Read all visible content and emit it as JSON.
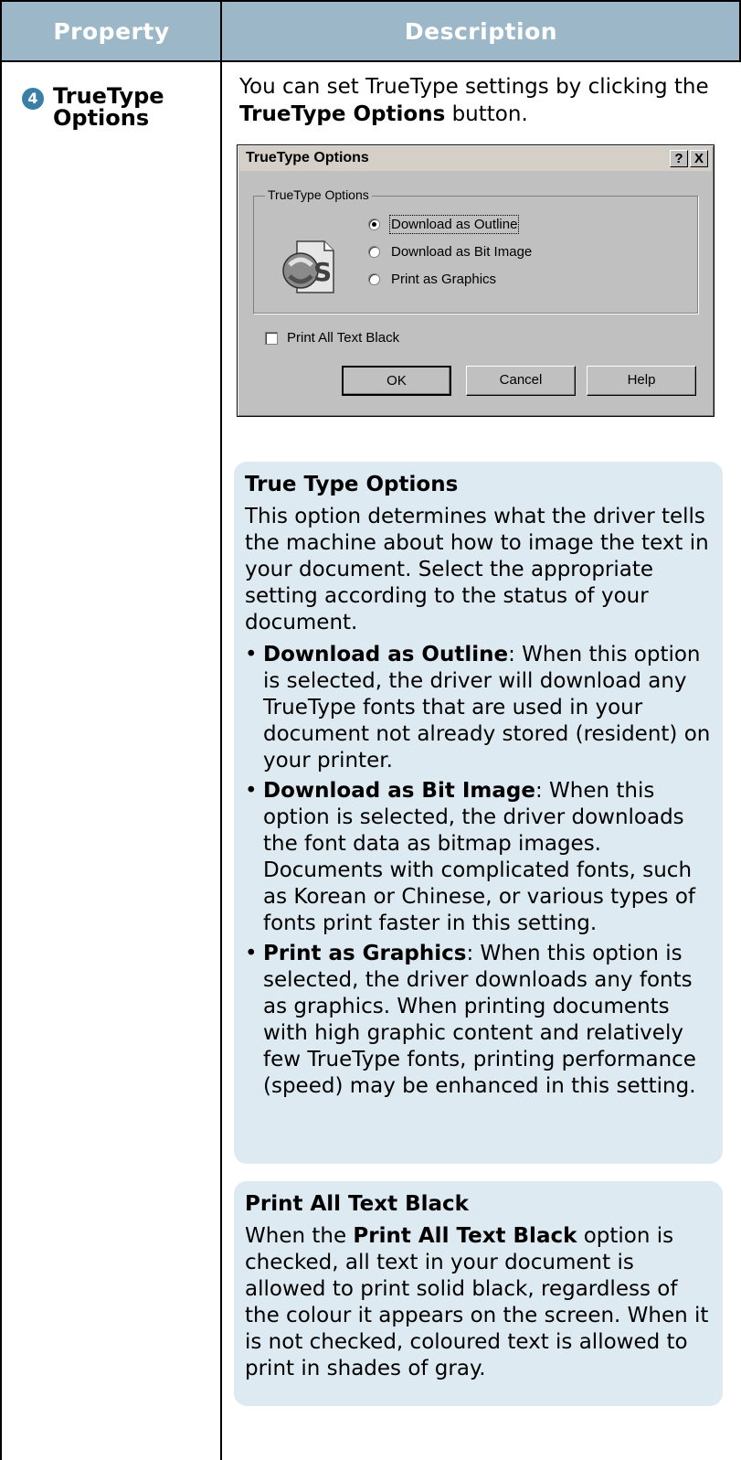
{
  "table": {
    "header": {
      "property": "Property",
      "description": "Description"
    },
    "row": {
      "number": "4",
      "property": "TrueType Options",
      "intro_text_1": "You can set TrueType settings by clicking the ",
      "intro_bold": "TrueType Options",
      "intro_text_2": " button."
    }
  },
  "dialog": {
    "title": "TrueType Options",
    "help_button": "?",
    "close_button": "X",
    "group_label": "TrueType Options",
    "radios": [
      {
        "label": "Download as Outline",
        "checked": true
      },
      {
        "label": "Download as Bit Image",
        "checked": false
      },
      {
        "label": "Print as Graphics",
        "checked": false
      }
    ],
    "checkbox": {
      "label": "Print All Text Black",
      "checked": false
    },
    "buttons": {
      "ok": "OK",
      "cancel": "Cancel",
      "help": "Help"
    }
  },
  "box1": {
    "title": "True Type Options",
    "intro": "This option determines what the driver tells the machine about how to image the text in your document. Select the appropriate setting according to the status of your document.",
    "items": [
      {
        "term": "Download as Outline",
        "text": ": When this option is selected, the driver will download any TrueType fonts that are used in your document not already stored (resident) on your printer."
      },
      {
        "term": "Download as Bit Image",
        "text": ": When this option is selected, the driver downloads the font data as bitmap images. Documents with complicated fonts, such as Korean or Chinese, or various types of fonts print faster in this setting."
      },
      {
        "term": "Print as Graphics",
        "text": ": When this option is selected, the driver downloads any fonts as graphics. When printing documents with high graphic content and relatively few TrueType fonts, printing performance (speed) may be enhanced in this setting."
      }
    ]
  },
  "box2": {
    "title": "Print All Text Black",
    "text_1": "When the ",
    "bold": "Print All Text Black",
    "text_2": " option is checked, all text in your document is allowed to print solid black, regardless of the colour it appears on the screen. When it is not checked, coloured text is allowed to print in shades of gray."
  },
  "colors": {
    "header_bg": "#9cb8c8",
    "box_bg": "#deeaf1",
    "badge": "#3a7fa6"
  }
}
